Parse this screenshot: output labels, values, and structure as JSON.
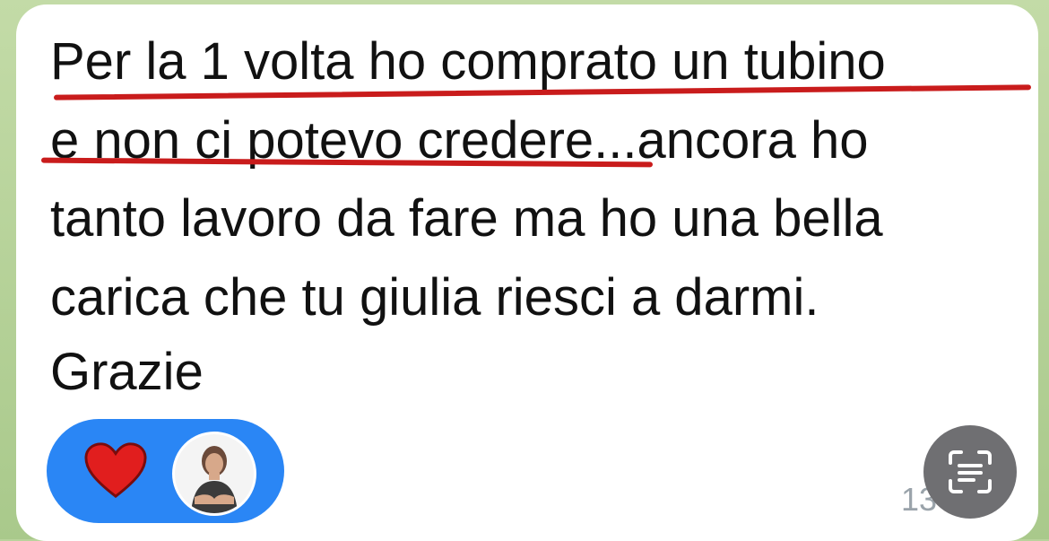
{
  "message": {
    "lines": [
      "Per la 1 volta ho comprato un tubino",
      "e non ci potevo credere...ancora ho",
      "tanto lavoro da fare ma ho una bella",
      "carica che tu giulia riesci a darmi.",
      "Grazie"
    ],
    "time": "13"
  },
  "reactions": {
    "heart_icon": "heart-icon",
    "avatar_icon": "user-avatar"
  },
  "colors": {
    "underline": "#c91c1c",
    "reaction_bg": "#2a86f5",
    "heart": "#e11e1e"
  },
  "scan_button_icon": "scan-text-icon"
}
